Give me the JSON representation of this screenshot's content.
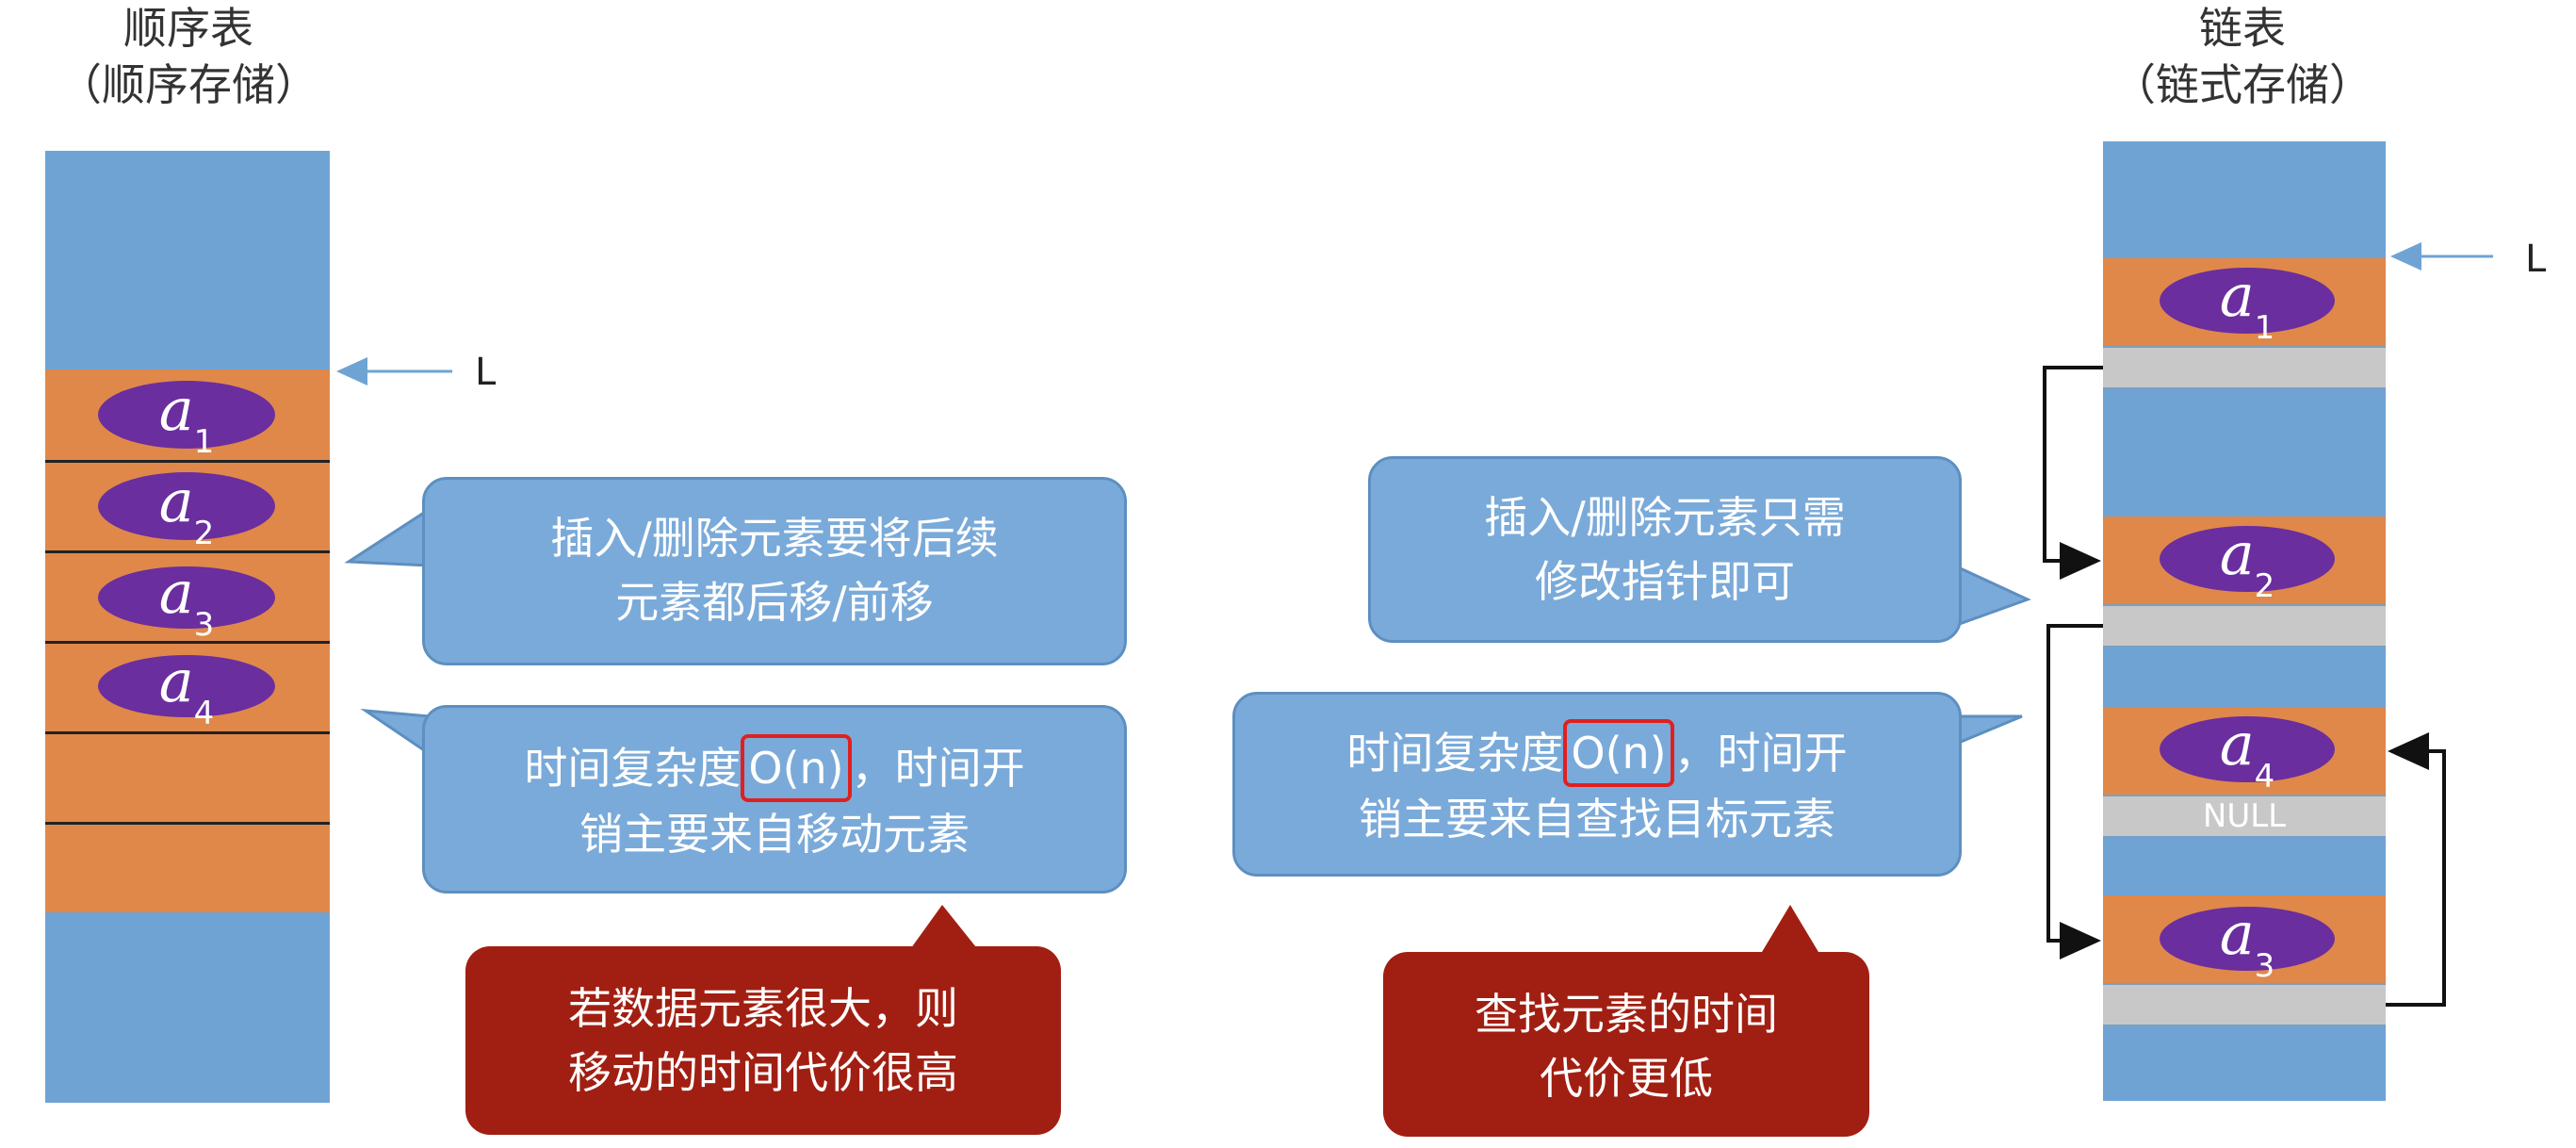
{
  "left": {
    "title_line1": "顺序表",
    "title_line2": "（顺序存储）",
    "pointer_label": "L",
    "elements": [
      {
        "base": "a",
        "sub": "1"
      },
      {
        "base": "a",
        "sub": "2"
      },
      {
        "base": "a",
        "sub": "3"
      },
      {
        "base": "a",
        "sub": "4"
      }
    ],
    "bubble1": {
      "line1": "插入/删除元素要将后续",
      "line2_pre": "元素都",
      "line2_ul": "后移/前移"
    },
    "bubble2": {
      "line1_pre": "时间复杂度",
      "line1_mark": "O(n)",
      "line1_post": "，时间开",
      "line2_pre": "销主要来自",
      "line2_ul": "移动元素"
    },
    "note": {
      "line1": "若数据元素很大，则",
      "line2": "移动的时间代价很高"
    }
  },
  "right": {
    "title_line1": "链表",
    "title_line2": "（链式存储）",
    "pointer_label": "L",
    "elements": [
      {
        "base": "a",
        "sub": "1"
      },
      {
        "base": "a",
        "sub": "2"
      },
      {
        "base": "a",
        "sub": "4"
      },
      {
        "base": "a",
        "sub": "3"
      }
    ],
    "null_label": "NULL",
    "bubble1": {
      "line1": "插入/删除元素只需",
      "line2": "修改指针即可"
    },
    "bubble2": {
      "line1_pre": "时间复杂度",
      "line1_mark": "O(n)",
      "line1_post": "，时间开",
      "line2_pre": "销主要来自",
      "line2_ul": "查找目标元素"
    },
    "note": {
      "line1": "查找元素的时间",
      "line2": "代价更低"
    }
  },
  "colors": {
    "memory_blue": "#6fa3d4",
    "slot_orange": "#e0884a",
    "element_purple": "#6a2e9e",
    "pointer_gray": "#c8c8c8",
    "bubble_blue": "#7aaad9",
    "note_red": "#a11f12",
    "highlight_red": "#e02020"
  }
}
